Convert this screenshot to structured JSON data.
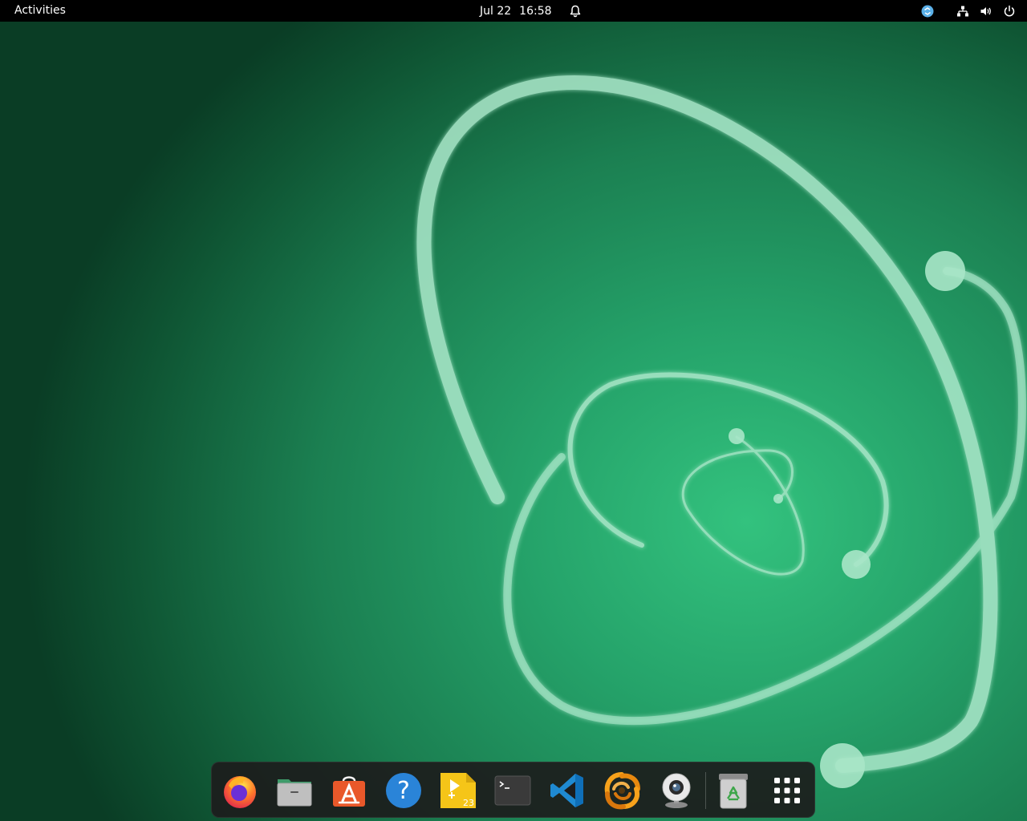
{
  "topbar": {
    "activities_label": "Activities",
    "date": "Jul 22",
    "time": "16:58",
    "icons": {
      "notification": "bell-icon",
      "accessibility": "app-indicator-icon",
      "network": "network-wired-icon",
      "volume": "volume-icon",
      "power": "power-icon"
    }
  },
  "dock": {
    "items": [
      {
        "name": "firefox",
        "icon": "firefox-icon"
      },
      {
        "name": "files",
        "icon": "files-folder-icon"
      },
      {
        "name": "app-center",
        "icon": "app-center-icon"
      },
      {
        "name": "help",
        "icon": "help-icon"
      },
      {
        "name": "impress",
        "icon": "presentation-icon"
      },
      {
        "name": "terminal",
        "icon": "terminal-icon"
      },
      {
        "name": "vscode",
        "icon": "vscode-icon"
      },
      {
        "name": "blender-like",
        "icon": "spiral-app-icon"
      },
      {
        "name": "cheese-webcam",
        "icon": "webcam-icon"
      },
      {
        "name": "trash",
        "icon": "trash-icon"
      },
      {
        "name": "show-apps",
        "icon": "app-grid-icon"
      }
    ],
    "impress_badge": "23"
  },
  "colors": {
    "accent": "#2fb87a",
    "wallpaper_dark": "#0a3d25",
    "topbar": "#000000"
  }
}
